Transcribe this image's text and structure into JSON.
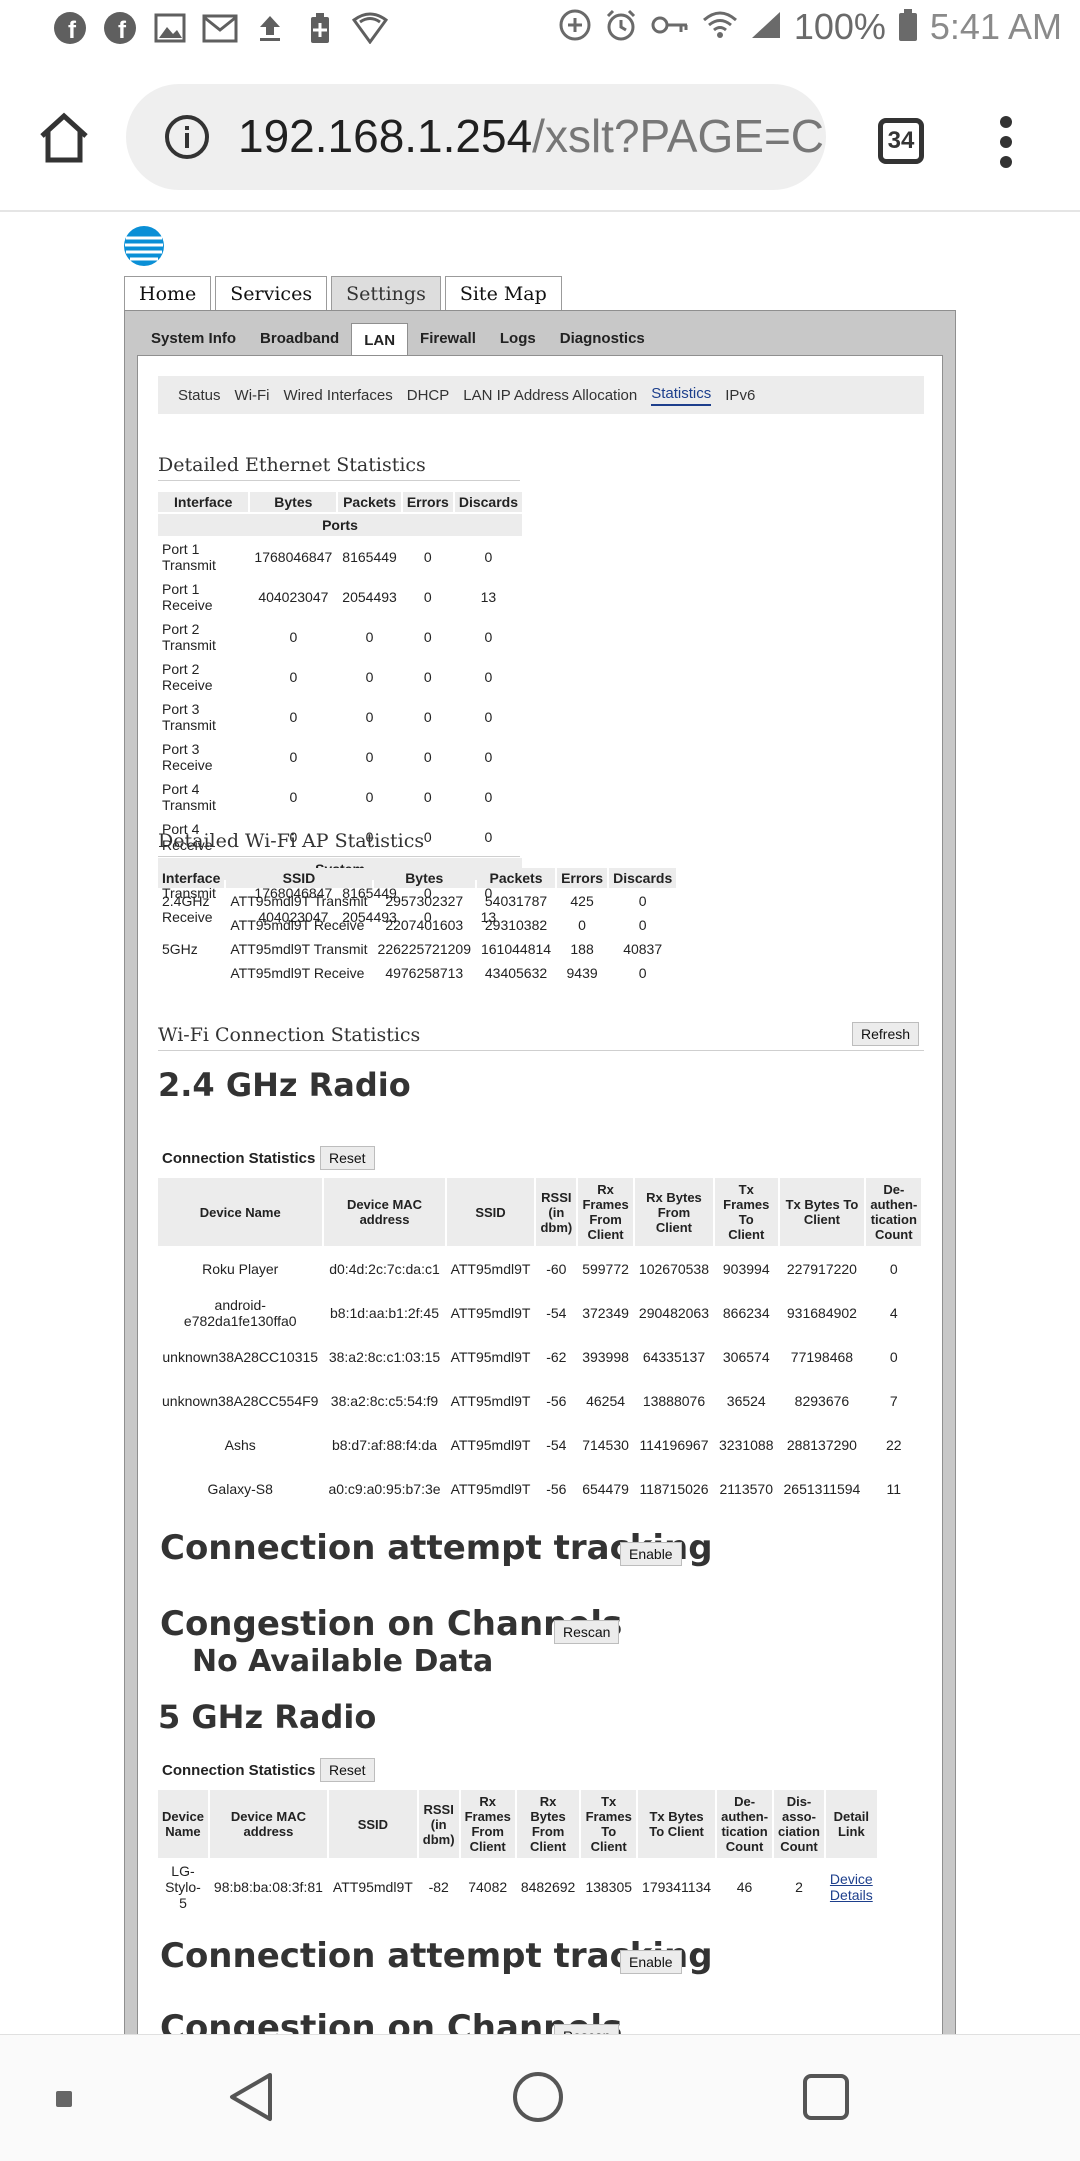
{
  "status_bar": {
    "left_icons": [
      "facebook-icon",
      "facebook-icon",
      "image-icon",
      "gmail-icon",
      "upload-icon",
      "battery-saver-icon",
      "shield-wifi-icon"
    ],
    "battery": "100%",
    "time": "5:41 AM"
  },
  "browser": {
    "url_host": "192.168.1.254",
    "url_path": "/xslt?PAGE=C",
    "tab_count": "34"
  },
  "main_tabs": [
    {
      "label": "Home"
    },
    {
      "label": "Services"
    },
    {
      "label": "Settings"
    },
    {
      "label": "Site Map"
    }
  ],
  "sub_tabs": [
    {
      "label": "System Info"
    },
    {
      "label": "Broadband"
    },
    {
      "label": "LAN"
    },
    {
      "label": "Firewall"
    },
    {
      "label": "Logs"
    },
    {
      "label": "Diagnostics"
    }
  ],
  "lan_nav": [
    {
      "label": "Status"
    },
    {
      "label": "Wi-Fi"
    },
    {
      "label": "Wired Interfaces"
    },
    {
      "label": "DHCP"
    },
    {
      "label": "LAN IP Address Allocation"
    },
    {
      "label": "Statistics"
    },
    {
      "label": "IPv6"
    }
  ],
  "ethernet": {
    "title": "Detailed Ethernet Statistics",
    "headers": [
      "Interface",
      "Bytes",
      "Packets",
      "Errors",
      "Discards"
    ],
    "ports_label": "Ports",
    "ports": [
      [
        "Port 1 Transmit",
        "1768046847",
        "8165449",
        "0",
        "0"
      ],
      [
        "Port 1 Receive",
        "404023047",
        "2054493",
        "0",
        "13"
      ],
      [
        "Port 2 Transmit",
        "0",
        "0",
        "0",
        "0"
      ],
      [
        "Port 2 Receive",
        "0",
        "0",
        "0",
        "0"
      ],
      [
        "Port 3 Transmit",
        "0",
        "0",
        "0",
        "0"
      ],
      [
        "Port 3 Receive",
        "0",
        "0",
        "0",
        "0"
      ],
      [
        "Port 4 Transmit",
        "0",
        "0",
        "0",
        "0"
      ],
      [
        "Port 4 Receive",
        "0",
        "0",
        "0",
        "0"
      ]
    ],
    "system_label": "System",
    "system": [
      [
        "Transmit",
        "1768046847",
        "8165449",
        "0",
        "0"
      ],
      [
        "Receive",
        "404023047",
        "2054493",
        "0",
        "13"
      ]
    ]
  },
  "wifi_ap": {
    "title": "Detailed Wi-Fi AP Statistics",
    "headers": [
      "Interface",
      "SSID",
      "Bytes",
      "Packets",
      "Errors",
      "Discards"
    ],
    "rows": [
      [
        "2.4GHz",
        "ATT95mdl9T Transmit",
        "2957302327",
        "54031787",
        "425",
        "0"
      ],
      [
        "",
        "ATT95mdl9T Receive",
        "2207401603",
        "29310382",
        "0",
        "0"
      ],
      [
        "5GHz",
        "ATT95mdl9T Transmit",
        "226225721209",
        "161044814",
        "188",
        "40837"
      ],
      [
        "",
        "ATT95mdl9T Receive",
        "4976258713",
        "43405632",
        "9439",
        "0"
      ]
    ]
  },
  "wifi_conn": {
    "title": "Wi-Fi Connection Statistics",
    "refresh_label": "Refresh",
    "radio24": {
      "title": "2.4 GHz Radio",
      "cs_label": "Connection Statistics",
      "reset_label": "Reset",
      "headers": [
        "Device Name",
        "Device MAC address",
        "SSID",
        "RSSI (in dbm)",
        "Rx Frames From Client",
        "Rx Bytes From Client",
        "Tx Frames To Client",
        "Tx Bytes To Client",
        "De-authen-tication Count"
      ],
      "rows": [
        [
          "Roku Player",
          "d0:4d:2c:7c:da:c1",
          "ATT95mdl9T",
          "-60",
          "599772",
          "102670538",
          "903994",
          "227917220",
          "0"
        ],
        [
          "android-e782da1fe130ffa0",
          "b8:1d:aa:b1:2f:45",
          "ATT95mdl9T",
          "-54",
          "372349",
          "290482063",
          "866234",
          "931684902",
          "4"
        ],
        [
          "unknown38A28CC10315",
          "38:a2:8c:c1:03:15",
          "ATT95mdl9T",
          "-62",
          "393998",
          "64335137",
          "306574",
          "77198468",
          "0"
        ],
        [
          "unknown38A28CC554F9",
          "38:a2:8c:c5:54:f9",
          "ATT95mdl9T",
          "-56",
          "46254",
          "13888076",
          "36524",
          "8293676",
          "7"
        ],
        [
          "Ashs",
          "b8:d7:af:88:f4:da",
          "ATT95mdl9T",
          "-54",
          "714530",
          "114196967",
          "3231088",
          "288137290",
          "22"
        ],
        [
          "Galaxy-S8",
          "a0:c9:a0:95:b7:3e",
          "ATT95mdl9T",
          "-56",
          "654479",
          "118715026",
          "2113570",
          "2651311594",
          "11"
        ]
      ],
      "tracking_title": "Connection attempt tracking",
      "enable_label": "Enable",
      "congestion_title": "Congestion on Channels",
      "rescan_label": "Rescan",
      "no_data": "No Available Data"
    },
    "radio5": {
      "title": "5 GHz Radio",
      "cs_label": "Connection Statistics",
      "reset_label": "Reset",
      "headers": [
        "Device Name",
        "Device MAC address",
        "SSID",
        "RSSI (in dbm)",
        "Rx Frames From Client",
        "Rx Bytes From Client",
        "Tx Frames To Client",
        "Tx Bytes To Client",
        "De-authen-tication Count",
        "Dis-asso-ciation Count",
        "Detail Link"
      ],
      "rows": [
        [
          "LG-Stylo-5",
          "98:b8:ba:08:3f:81",
          "ATT95mdl9T",
          "-82",
          "74082",
          "8482692",
          "138305",
          "179341134",
          "46",
          "2",
          "Device Details"
        ]
      ],
      "tracking_title": "Connection attempt tracking",
      "enable_label": "Enable",
      "congestion_title": "Congestion on Channels",
      "rescan_label": "Rescan"
    }
  }
}
